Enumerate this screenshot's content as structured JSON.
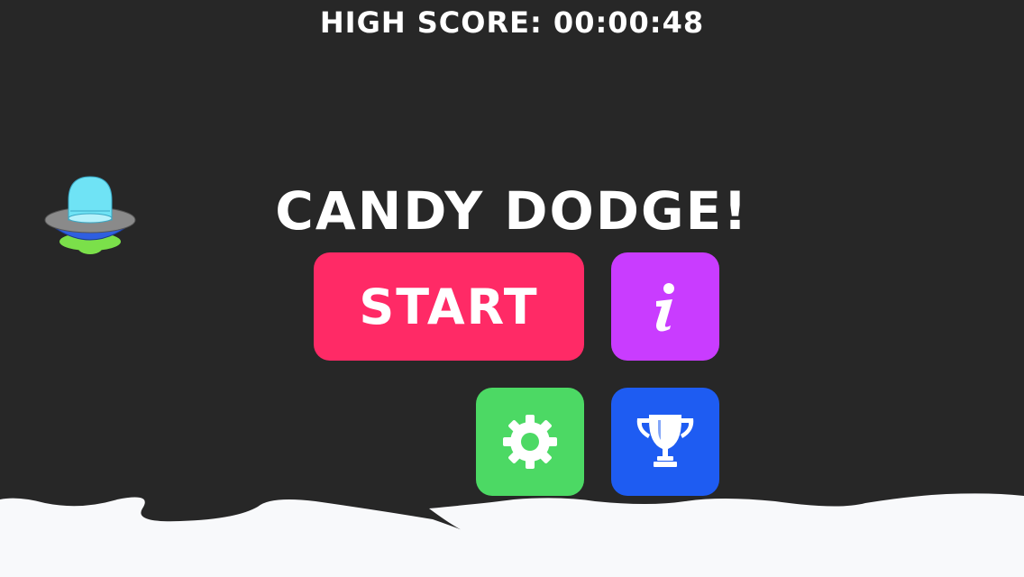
{
  "hud": {
    "high_score": "HIGH SCORE: 00:00:48"
  },
  "title": "CANDY DODGE!",
  "menu": {
    "start_label": "START",
    "info_icon": "info-icon",
    "settings_icon": "gear-icon",
    "leaderboard_icon": "trophy-icon"
  },
  "colors": {
    "background": "#272727",
    "start": "#ff2a66",
    "info": "#c93cff",
    "settings": "#4cd964",
    "leaderboard": "#1e5cf2",
    "ground": "#f8f9fb"
  }
}
